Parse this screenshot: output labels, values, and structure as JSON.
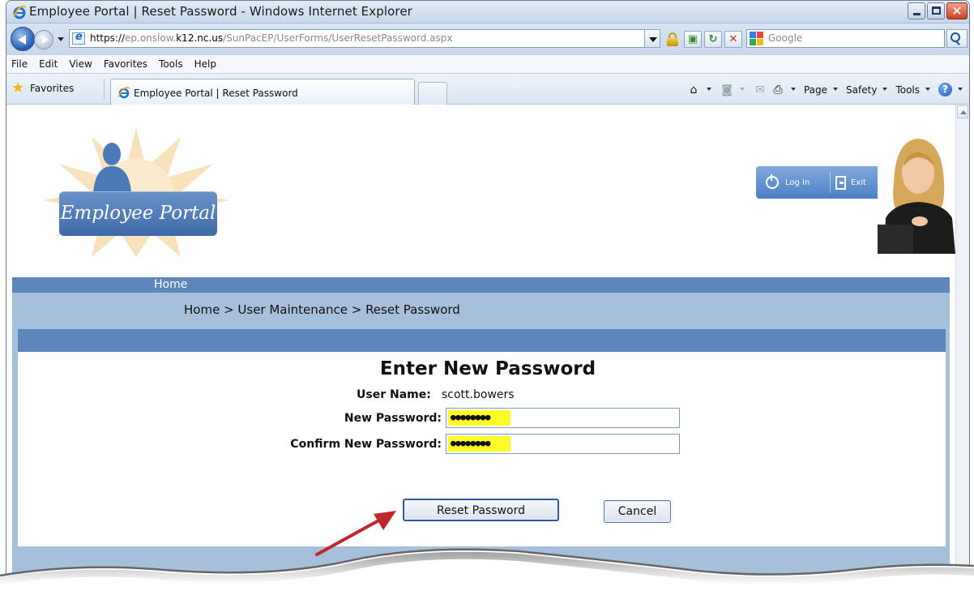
{
  "window": {
    "title": "Employee Portal | Reset Password - Windows Internet Explorer"
  },
  "address_bar": {
    "scheme": "https://",
    "host_prefix": "ep.onslow.",
    "host_domain": "k12.nc.us",
    "path": "/SunPacEP/UserForms/UserResetPassword.aspx",
    "search_placeholder": "Google"
  },
  "menu": [
    "File",
    "Edit",
    "View",
    "Favorites",
    "Tools",
    "Help"
  ],
  "favorites_label": "Favorites",
  "tab": {
    "label": "Employee Portal | Reset Password"
  },
  "command_bar": {
    "page": "Page",
    "safety": "Safety",
    "tools": "Tools"
  },
  "portal": {
    "logo_text": "Employee Portal",
    "login_label": "Log In",
    "exit_label": "Exit",
    "nav_home": "Home",
    "breadcrumb": "Home > User Maintenance > Reset Password"
  },
  "form": {
    "title": "Enter New Password",
    "username_label": "User Name:",
    "username_value": "scott.bowers",
    "new_password_label": "New Password:",
    "new_password_value": "●●●●●●●●",
    "confirm_password_label": "Confirm New Password:",
    "confirm_password_value": "●●●●●●●●",
    "reset_button": "Reset Password",
    "cancel_button": "Cancel"
  },
  "colors": {
    "nav_blue": "#5d86bb",
    "light_blue": "#a6c0db",
    "highlight_yellow": "#fffb26",
    "annotation_arrow": "#c0272d"
  }
}
